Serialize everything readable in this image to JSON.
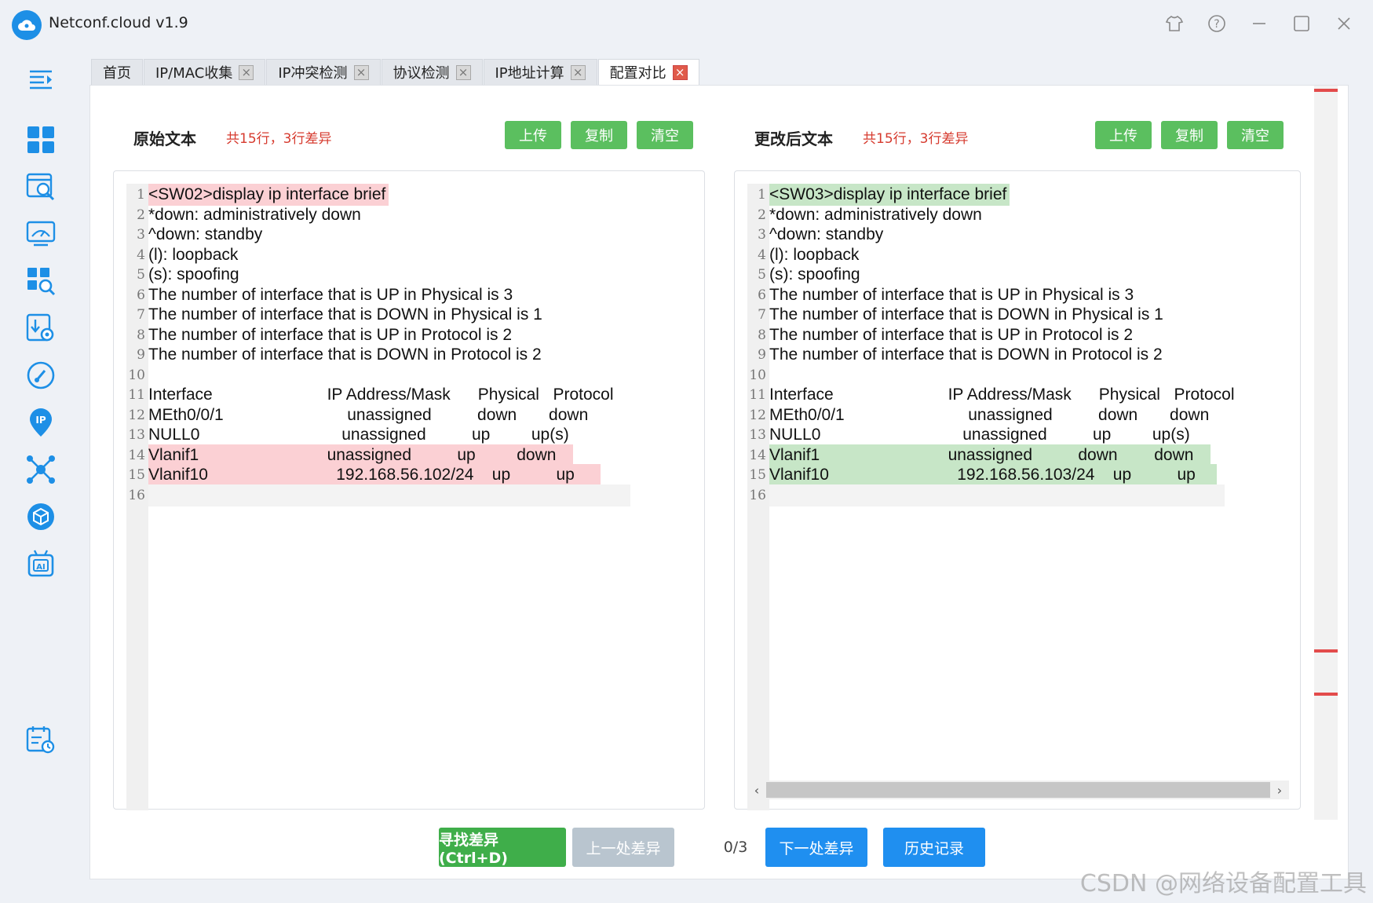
{
  "app": {
    "title": "Netconf.cloud v1.9"
  },
  "window_controls": [
    "shirt-icon",
    "help-icon",
    "minimize-icon",
    "maximize-icon",
    "close-icon"
  ],
  "tabs": [
    {
      "label": "首页"
    },
    {
      "label": "IP/MAC收集"
    },
    {
      "label": "IP冲突检测"
    },
    {
      "label": "协议检测"
    },
    {
      "label": "IP地址计算"
    },
    {
      "label": "配置对比"
    }
  ],
  "left": {
    "title": "原始文本",
    "stat": "共15行，3行差异",
    "upload": "上传",
    "copy": "复制",
    "clear": "清空",
    "lines": [
      "<SW02>display ip interface brief",
      "*down: administratively down",
      "^down: standby",
      "(l): loopback",
      "(s): spoofing",
      "The number of interface that is UP in Physical is 3",
      "The number of interface that is DOWN in Physical is 1",
      "The number of interface that is UP in Protocol is 2",
      "The number of interface that is DOWN in Protocol is 2",
      "",
      "Interface                         IP Address/Mask      Physical   Protocol",
      "MEth0/0/1                           unassigned          down       down",
      "NULL0                               unassigned          up         up(s)",
      "Vlanif1                            unassigned          up         down   ",
      "Vlanif10                            192.168.56.102/24    up          up     ",
      ""
    ]
  },
  "right": {
    "title": "更改后文本",
    "stat": "共15行，3行差异",
    "upload": "上传",
    "copy": "复制",
    "clear": "清空",
    "lines": [
      "<SW03>display ip interface brief",
      "*down: administratively down",
      "^down: standby",
      "(l): loopback",
      "(s): spoofing",
      "The number of interface that is UP in Physical is 3",
      "The number of interface that is DOWN in Physical is 1",
      "The number of interface that is UP in Protocol is 2",
      "The number of interface that is DOWN in Protocol is 2",
      "",
      "Interface                         IP Address/Mask      Physical   Protocol",
      "MEth0/0/1                           unassigned          down       down",
      "NULL0                               unassigned          up         up(s)",
      "Vlanif1                            unassigned          down        down   ",
      "Vlanif10                            192.168.56.103/24    up          up    ",
      ""
    ]
  },
  "bottom": {
    "find": "寻找差异 (Ctrl+D)",
    "prev": "上一处差异",
    "counter": "0/3",
    "next": "下一处差异",
    "history": "历史记录"
  },
  "watermark": "CSDN @网络设备配置工具",
  "colors": {
    "accent": "#1d8fe6",
    "green_button": "#5bbf5f",
    "find_button": "#3fae4a",
    "disabled_button": "#b9c5cf",
    "blue_button": "#1f8ff0",
    "deleted_highlight": "#fbd0d4",
    "added_highlight": "#c7e6c7",
    "diff_marker": "#e34b4b",
    "stat_text": "#d63a2e"
  }
}
